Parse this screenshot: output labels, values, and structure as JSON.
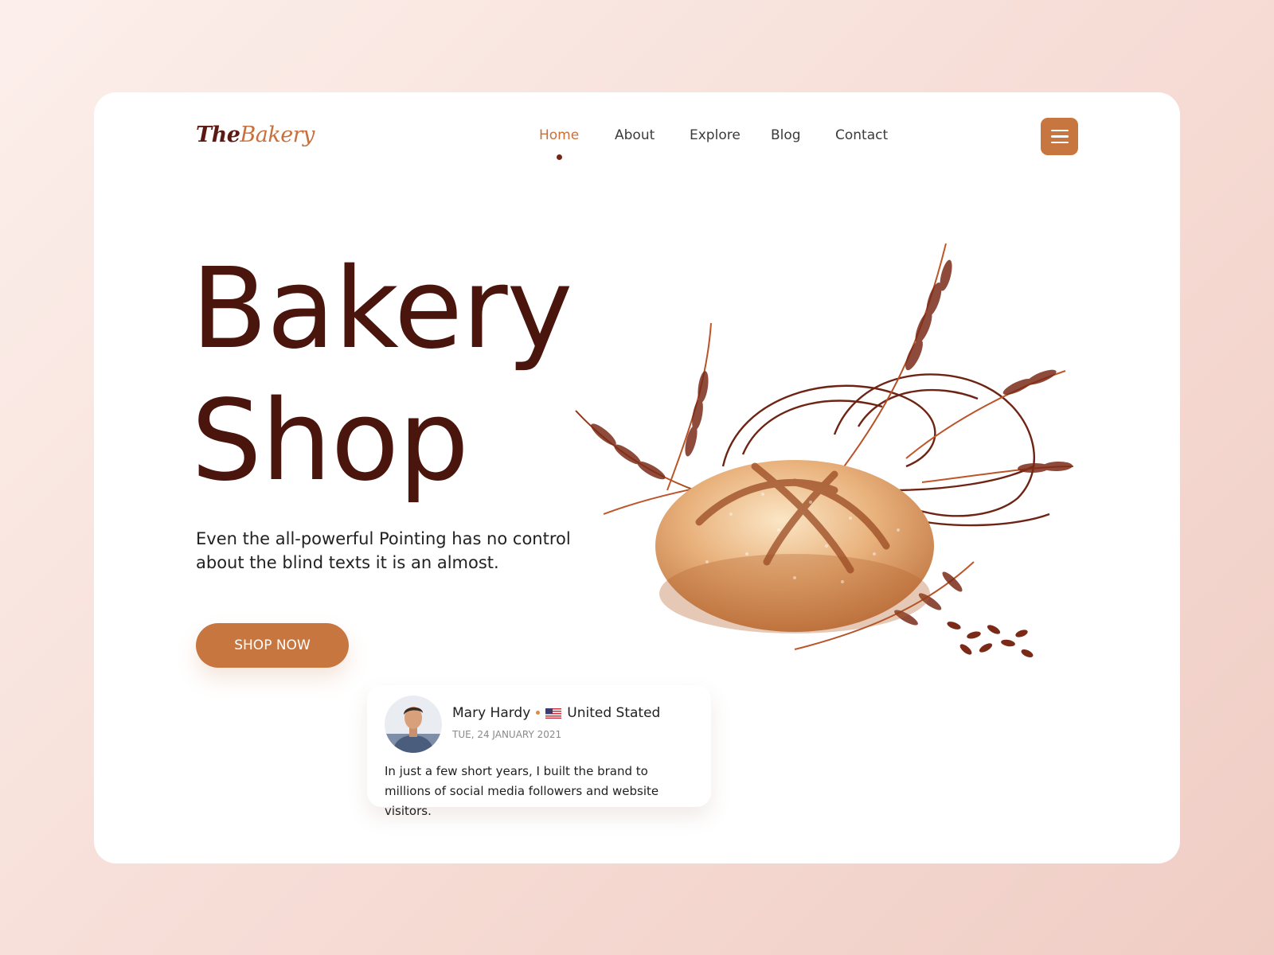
{
  "brand": {
    "logo_part1": "The",
    "logo_part2": "Bakery"
  },
  "nav": {
    "items": [
      {
        "label": "Home",
        "active": true
      },
      {
        "label": "About",
        "active": false
      },
      {
        "label": "Explore",
        "active": false
      },
      {
        "label": "Blog",
        "active": false
      },
      {
        "label": "Contact",
        "active": false
      }
    ],
    "menu_icon": "hamburger-menu-icon"
  },
  "hero": {
    "title_line1": "Bakery",
    "title_line2": "Shop",
    "description": "Even the all-powerful Pointing has no control about the blind texts it is an almost.",
    "cta_label": "SHOP NOW",
    "illustration": "bread-and-wheat-illustration"
  },
  "testimonial": {
    "name": "Mary Hardy",
    "country": "United Stated",
    "flag_icon": "us-flag-icon",
    "date": "TUE, 24 JANUARY 2021",
    "text": "In just a few short years, I built the brand to millions of social media followers and website visitors."
  },
  "colors": {
    "accent": "#c87640",
    "title": "#4a150d",
    "nav_active": "#c7703c",
    "background": "#f6dcd5"
  }
}
